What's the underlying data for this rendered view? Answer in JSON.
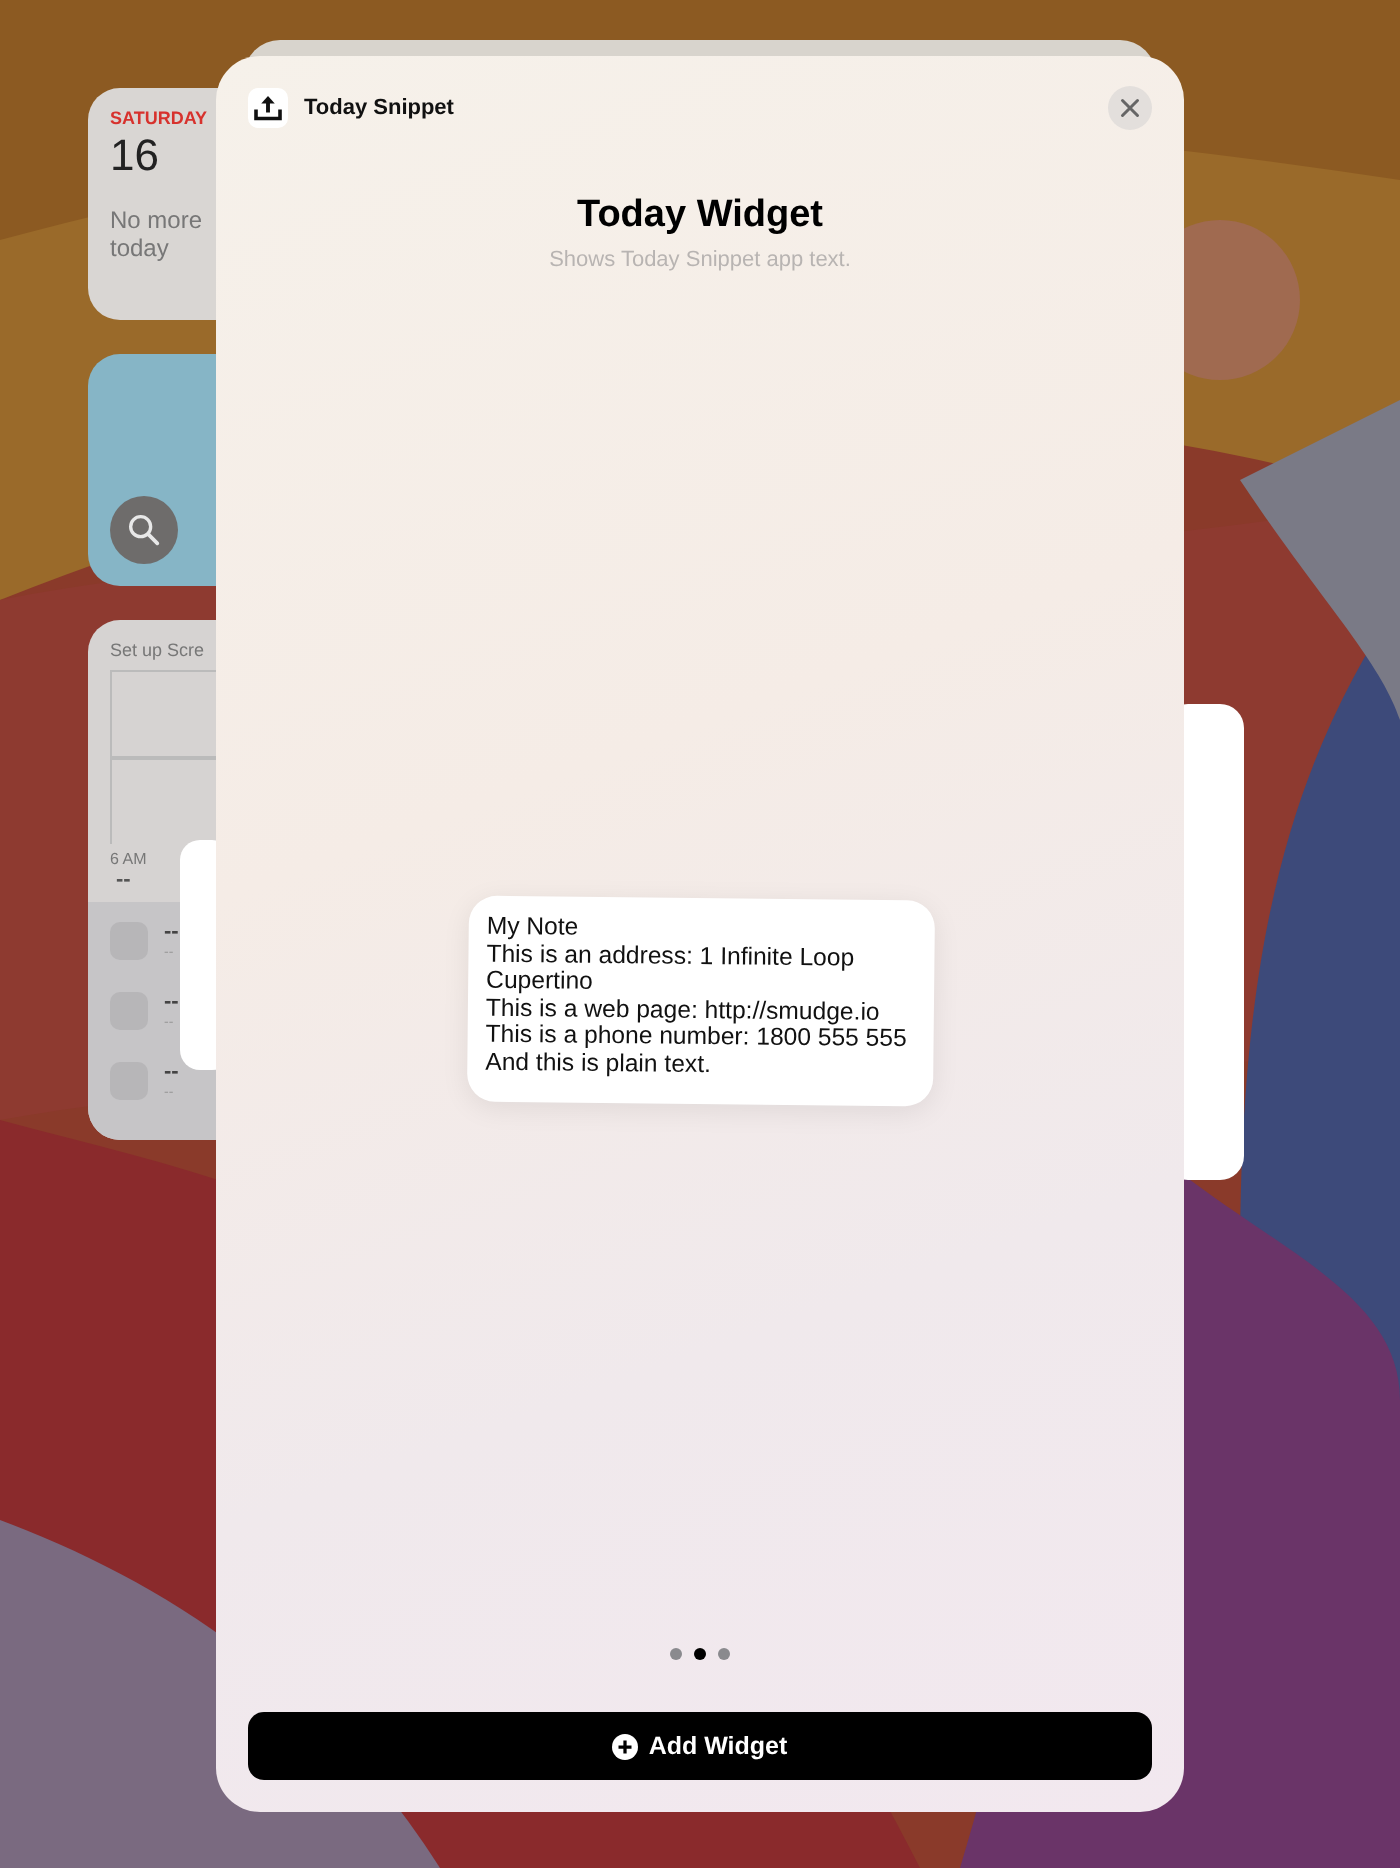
{
  "background_widgets": {
    "calendar": {
      "weekday": "SATURDAY",
      "date": "16",
      "lines": [
        "No more",
        "today"
      ]
    },
    "screen_time": {
      "title": "Set up Scre",
      "time": "6 AM",
      "value": "--",
      "rows": [
        {
          "title": "--",
          "subtitle": "--"
        },
        {
          "title": "--",
          "subtitle": "--"
        },
        {
          "title": "--",
          "subtitle": "--"
        }
      ]
    }
  },
  "sheet": {
    "app_name": "Today Snippet",
    "title": "Today Widget",
    "subtitle": "Shows Today Snippet app text.",
    "widget": {
      "lines": [
        "My Note",
        "This is an address: 1 Infinite Loop Cupertino",
        "This is a web page: http://smudge.io",
        "This is a phone number: 1800 555 555",
        "And this is plain text."
      ]
    },
    "page_dots": [
      {
        "selected": false
      },
      {
        "selected": true
      },
      {
        "selected": false
      }
    ],
    "add_button": {
      "label": "Add Widget"
    }
  }
}
